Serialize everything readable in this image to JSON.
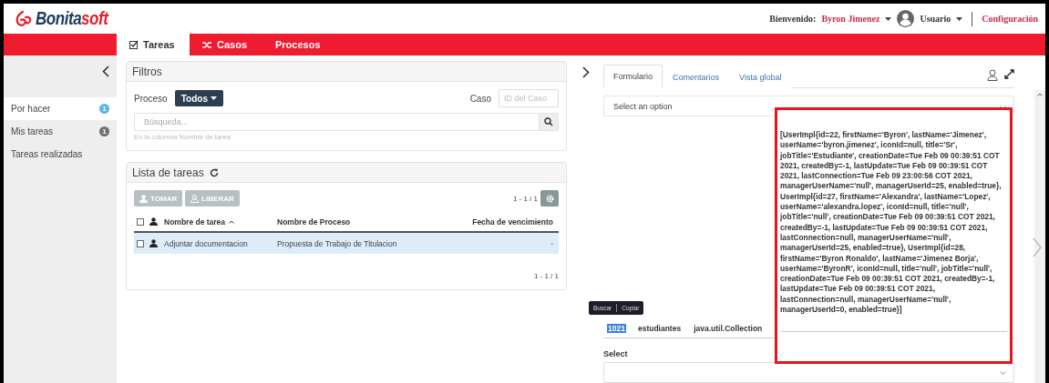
{
  "header": {
    "logo": {
      "main": "Bonita",
      "accent": "soft"
    },
    "welcome_label": "Bienvenido:",
    "user_name": "Byron Jimenez",
    "user_menu": "Usuario",
    "settings_link": "Configuración"
  },
  "nav_tabs": [
    {
      "label": "Tareas",
      "selected": true,
      "kind": "tasks"
    },
    {
      "label": "Casos",
      "selected": false,
      "kind": "cases"
    },
    {
      "label": "Procesos",
      "selected": false,
      "kind": "plain"
    }
  ],
  "sidebar": {
    "items": [
      {
        "label": "Por hacer",
        "badge": "1",
        "selected": true,
        "color": "#5bb5e6"
      },
      {
        "label": "Mis tareas",
        "badge": "1",
        "selected": false,
        "color": "#6f6f6f"
      },
      {
        "label": "Tareas realizadas",
        "selected": false
      }
    ]
  },
  "filters": {
    "title": "Filtros",
    "process_label": "Proceso",
    "process_button": "Todos",
    "case_label": "Caso",
    "case_placeholder": "ID del Caso",
    "search_placeholder": "Búsqueda...",
    "search_hint": "En la columna Nombre de tarea"
  },
  "task_list": {
    "title": "Lista de tareas",
    "buttons": [
      {
        "label": "TOMAR",
        "kind": "take"
      },
      {
        "label": "LIBERAR",
        "kind": "release"
      }
    ],
    "pager_top": "1 - 1 / 1",
    "pager_bottom": "1 - 1 / 1",
    "header_checked": false,
    "columns": [
      "Nombre de tarea",
      "Nombre de Proceso",
      "Fecha de vencimiento"
    ],
    "rows": [
      {
        "checked": false,
        "selected": true,
        "cells": [
          "Adjuntar documentacion",
          "Propuesta de Trabajo de Titulacion",
          "-"
        ]
      }
    ]
  },
  "detail": {
    "tabs": [
      {
        "label": "Formulario",
        "selected": true
      },
      {
        "label": "Comentarios",
        "selected": false
      },
      {
        "label": "Vista global",
        "selected": false
      }
    ],
    "select_value": "Select an option",
    "context_menu": [
      "Buscar",
      "Copiar"
    ],
    "collection_row": [
      {
        "text": "1021",
        "selected": true
      },
      {
        "text": "estudiantes",
        "selected": false
      },
      {
        "text": "java.util.Collection",
        "selected": false
      }
    ],
    "select_label": "Select",
    "output_text": "[UserImpl{id=22, firstName='Byron', lastName='Jimenez', userName='byron.jimenez', iconId=null, title='Sr', jobTitle='Estudiante', creationDate=Tue Feb 09 00:39:51 COT 2021, createdBy=-1, lastUpdate=Tue Feb 09 00:39:51 COT 2021, lastConnection=Tue Feb 09 23:00:56 COT 2021, managerUserName='null', managerUserId=25, enabled=true}, UserImpl{id=27, firstName='Alexandra', lastName='Lopez', userName='alexandra.lopez', iconId=null, title='null', jobTitle='null', creationDate=Tue Feb 09 00:39:51 COT 2021, createdBy=-1, lastUpdate=Tue Feb 09 00:39:51 COT 2021, lastConnection=null, managerUserName='null', managerUserId=25, enabled=true}, UserImpl{id=28, firstName='Byron Ronaldo', lastName='Jimenez Borja', userName='ByronR', iconId=null, title='null', jobTitle='null', creationDate=Tue Feb 09 00:39:51 COT 2021, createdBy=-1, lastUpdate=Tue Feb 09 00:39:51 COT 2021, lastConnection=null, managerUserName='null', managerUserId=0, enabled=true}]"
  }
}
